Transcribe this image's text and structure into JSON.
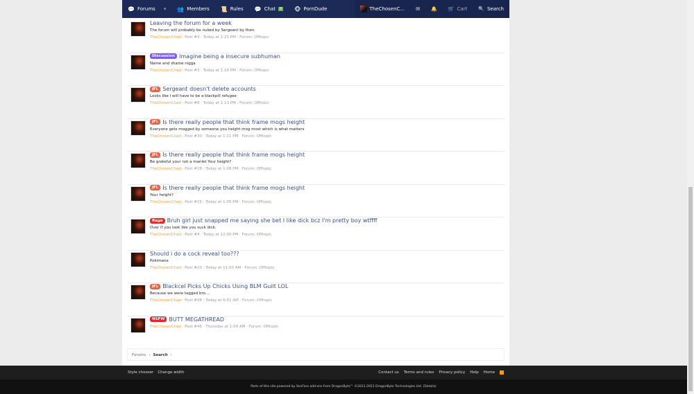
{
  "nav": {
    "forums": "Forums",
    "members": "Members",
    "rules": "Rules",
    "chat": "Chat",
    "chat_badge": "8",
    "porndude": "PornDude",
    "user": "TheChosenC...",
    "cart": "Cart",
    "search": "Search"
  },
  "results": [
    {
      "badge": "",
      "title": "Leaving the forum for a week",
      "snippet": "The forum will probably be nuked by Sergeant by then.",
      "user": "TheChosenChad",
      "post": "Post #3",
      "time": "Today at 1:21 PM",
      "forum": "Forum: Offtopic"
    },
    {
      "badge": "Discussion",
      "badge_color": "#7a5cf0",
      "title": "Imagine being a insecure subhuman",
      "snippet": "Name and shame nigga",
      "user": "TheChosenChad",
      "post": "Post #3",
      "time": "Today at 1:16 PM",
      "forum": "Forum: Offtopic"
    },
    {
      "badge": "JFL",
      "badge_color": "#e0664a",
      "title": "Sergeant doesn't delete accounts",
      "snippet": "Looks like I will have to be a blackpill refugee",
      "user": "TheChosenChad",
      "post": "Post #8",
      "time": "Today at 1:13 PM",
      "forum": "Forum: Offtopic"
    },
    {
      "badge": "JFL",
      "badge_color": "#e0664a",
      "title": "Is there really people that think frame mogs height",
      "snippet": "Everyone gets mogged by someone you height mog most which is what matters",
      "user": "TheChosenChad",
      "post": "Post #30",
      "time": "Today at 1:11 PM",
      "forum": "Forum: Offtopic"
    },
    {
      "badge": "JFL",
      "badge_color": "#e0664a",
      "title": "Is there really people that think frame mogs height",
      "snippet": "Be grateful your not a manlet Your height?",
      "user": "TheChosenChad",
      "post": "Post #28",
      "time": "Today at 1:08 PM",
      "forum": "Forum: Offtopic"
    },
    {
      "badge": "JFL",
      "badge_color": "#e0664a",
      "title": "Is there really people that think frame mogs height",
      "snippet": "Your height?",
      "user": "TheChosenChad",
      "post": "Post #25",
      "time": "Today at 1:05 PM",
      "forum": "Forum: Offtopic"
    },
    {
      "badge": "Rage",
      "badge_color": "#d9302c",
      "title": "Bruh girl just snapped me saying she bet I like dick bcz I'm pretty boy wtffff",
      "snippet": "Over if you look like you suck dick.",
      "user": "TheChosenChad",
      "post": "Post #4",
      "time": "Today at 12:00 PM",
      "forum": "Forum: Offtopic"
    },
    {
      "badge": "",
      "title": "Should i do a cock reveal too???",
      "snippet": "Pokimane",
      "user": "TheChosenChad",
      "post": "Post #20",
      "time": "Today at 11:50 AM",
      "forum": "Forum: Offtopic"
    },
    {
      "badge": "JFL",
      "badge_color": "#e0664a",
      "title": "Blackcel Picks Up Chicks Using BLM Guilt LOL",
      "snippet": "Because we were tagged bro....",
      "user": "TheChosenChad",
      "post": "Post #38",
      "time": "Today at 6:51 AM",
      "forum": "Forum: Offtopic"
    },
    {
      "badge": "NSFW",
      "badge_color": "#e8262a",
      "title": "BUTT MEGATHREAD",
      "snippet": "",
      "user": "TheChosenChad",
      "post": "Post #45",
      "time": "Thursday at 1:04 AM",
      "forum": "Forum: Offtopic"
    }
  ],
  "breadcrumb": {
    "forums": "Forums",
    "search": "Search"
  },
  "footer": {
    "style": "Style chooser",
    "width": "Change width",
    "contact": "Contact us",
    "terms": "Terms and rules",
    "privacy": "Privacy policy",
    "help": "Help",
    "home": "Home",
    "copyright": "Parts of this site powered by XenForo add-ons from DragonByte™ ©2011-2021 DragonByte Technologies Ltd. (Details)"
  }
}
